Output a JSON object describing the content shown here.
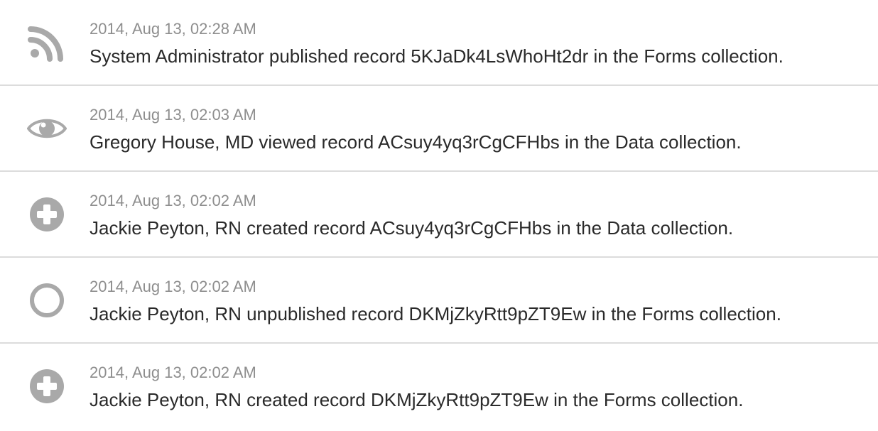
{
  "activity": {
    "items": [
      {
        "icon": "rss-feed-icon",
        "timestamp": "2014, Aug 13, 02:28 AM",
        "message": "System Administrator published record 5KJaDk4LsWhoHt2dr in the Forms collection."
      },
      {
        "icon": "eye-icon",
        "timestamp": "2014, Aug 13, 02:03 AM",
        "message": "Gregory House, MD viewed record ACsuy4yq3rCgCFHbs in the Data collection."
      },
      {
        "icon": "plus-circle-icon",
        "timestamp": "2014, Aug 13, 02:02 AM",
        "message": "Jackie Peyton, RN created record ACsuy4yq3rCgCFHbs in the Data collection."
      },
      {
        "icon": "empty-circle-icon",
        "timestamp": "2014, Aug 13, 02:02 AM",
        "message": "Jackie Peyton, RN unpublished record DKMjZkyRtt9pZT9Ew in the Forms collection."
      },
      {
        "icon": "plus-circle-icon",
        "timestamp": "2014, Aug 13, 02:02 AM",
        "message": "Jackie Peyton, RN created record DKMjZkyRtt9pZT9Ew in the Forms collection."
      }
    ]
  },
  "colors": {
    "icon": "#a9a9a9",
    "timestamp": "#8e8e8e",
    "message": "#2a2a2a",
    "divider": "#dcdcdc"
  }
}
